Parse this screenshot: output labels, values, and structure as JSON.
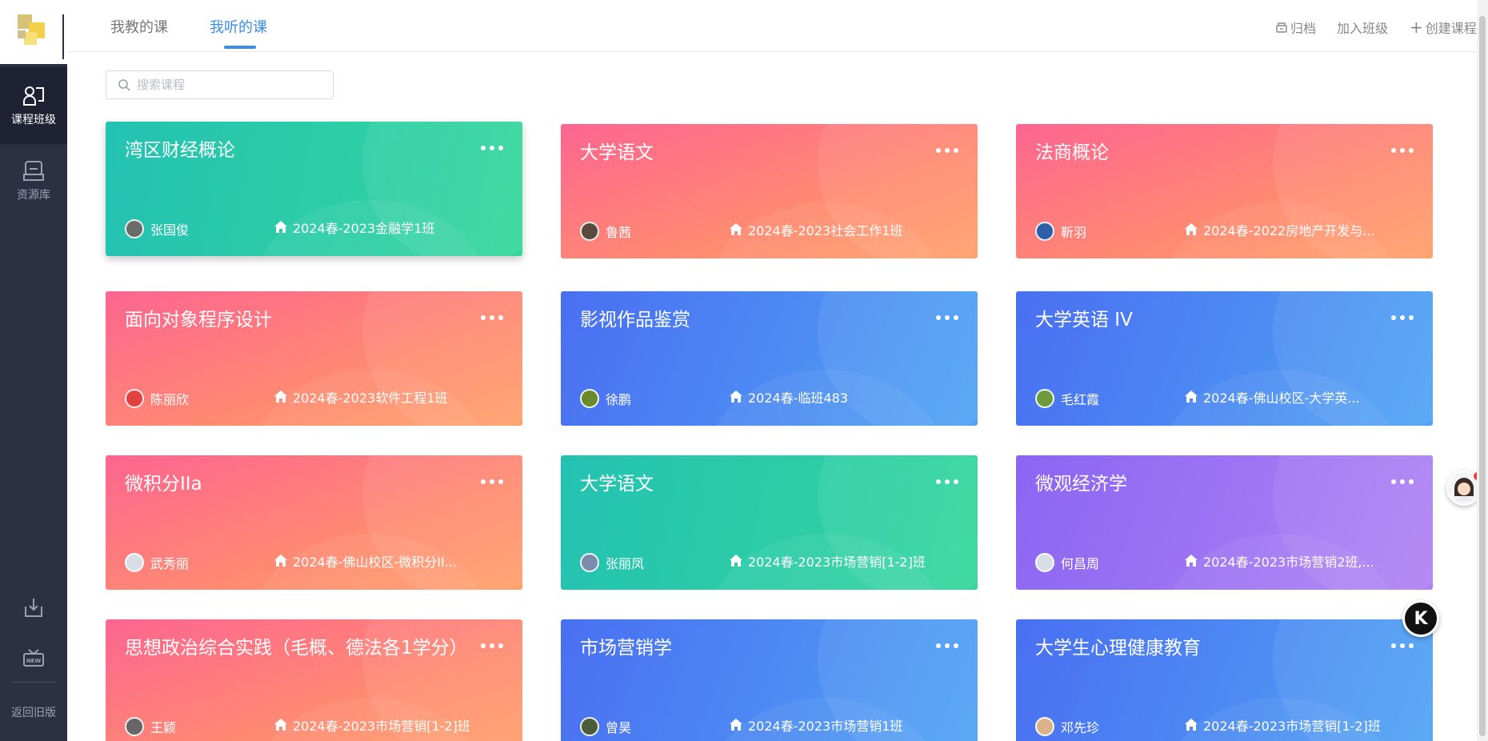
{
  "sidebar": {
    "nav": [
      {
        "label": "课程班级",
        "icon": "class-icon",
        "active": true
      },
      {
        "label": "资源库",
        "icon": "library-icon",
        "active": false
      }
    ],
    "bottom_icons": [
      "download-icon",
      "new-feature-icon"
    ],
    "back_label": "返回旧版"
  },
  "header": {
    "tabs": [
      {
        "label": "我教的课",
        "active": false
      },
      {
        "label": "我听的课",
        "active": true
      }
    ],
    "actions": {
      "archive": "归档",
      "join": "加入班级",
      "create": "创建课程"
    }
  },
  "search": {
    "placeholder": "搜索课程",
    "value": ""
  },
  "courses": [
    {
      "title": "湾区财经概论",
      "teacher": "张国俊",
      "class": "2024春-2023金融学1班",
      "theme": "green"
    },
    {
      "title": "大学语文",
      "teacher": "鲁茜",
      "class": "2024春-2023社会工作1班",
      "theme": "pink"
    },
    {
      "title": "法商概论",
      "teacher": "靳羽",
      "class": "2024春-2022房地产开发与...",
      "theme": "pink"
    },
    {
      "title": "面向对象程序设计",
      "teacher": "陈丽欣",
      "class": "2024春-2023软件工程1班",
      "theme": "pink"
    },
    {
      "title": "影视作品鉴赏",
      "teacher": "徐鹏",
      "class": "2024春-临班483",
      "theme": "blue"
    },
    {
      "title": "大学英语 IV",
      "teacher": "毛红霞",
      "class": "2024春-佛山校区-大学英...",
      "theme": "blue"
    },
    {
      "title": "微积分IIa",
      "teacher": "武秀丽",
      "class": "2024春-佛山校区-微积分II...",
      "theme": "pink"
    },
    {
      "title": "大学语文",
      "teacher": "张丽凤",
      "class": "2024春-2023市场营销[1-2]班",
      "theme": "green"
    },
    {
      "title": "微观经济学",
      "teacher": "何昌周",
      "class": "2024春-2023市场营销2班,...",
      "theme": "purple"
    },
    {
      "title": "思想政治综合实践（毛概、德法各1学分）",
      "teacher": "王颖",
      "class": "2024春-2023市场营销[1-2]班",
      "theme": "pink"
    },
    {
      "title": "市场营销学",
      "teacher": "曾昊",
      "class": "2024春-2023市场营销1班",
      "theme": "blue"
    },
    {
      "title": "大学生心理健康教育",
      "teacher": "邓先珍",
      "class": "2024春-2023市场营销[1-2]班",
      "theme": "blue"
    }
  ],
  "floating": {
    "k_label": "K"
  },
  "colors": {
    "accent": "#3a8ee6",
    "sidebar": "#2c3042",
    "pink": "#fd6590",
    "green": "#24c2b2",
    "blue": "#4a6ff2",
    "purple": "#8b66f3"
  }
}
